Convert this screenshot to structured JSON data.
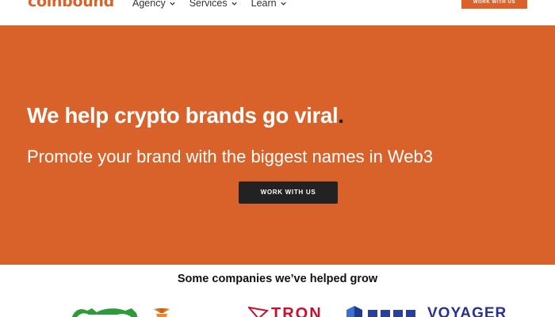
{
  "header": {
    "logo_text": "coinbound",
    "nav": [
      {
        "label": "Agency",
        "icon": "chevron-down-icon"
      },
      {
        "label": "Services",
        "icon": "chevron-down-icon"
      },
      {
        "label": "Learn",
        "icon": "chevron-down-icon"
      }
    ],
    "cta_label": "WORK WITH US"
  },
  "hero": {
    "headline": "We help crypto brands go viral",
    "headline_punct": ".",
    "subheadline": "Promote your brand with the biggest names in Web3",
    "cta_label": "WORK WITH US"
  },
  "clients": {
    "heading": "Some companies we’ve helped grow",
    "logos": [
      {
        "name": "green-logo"
      },
      {
        "name": "metamask-fox-logo"
      },
      {
        "name": "tron-logo",
        "text": "TRON"
      },
      {
        "name": "cube-logo"
      },
      {
        "name": "blue-wordmark-logo"
      },
      {
        "name": "voyager-logo",
        "text": "VOYAGER"
      }
    ]
  },
  "colors": {
    "brand_orange": "#d9622b",
    "dark_button": "#222222",
    "tron_red": "#c8102e",
    "voyager_blue": "#29318e"
  }
}
